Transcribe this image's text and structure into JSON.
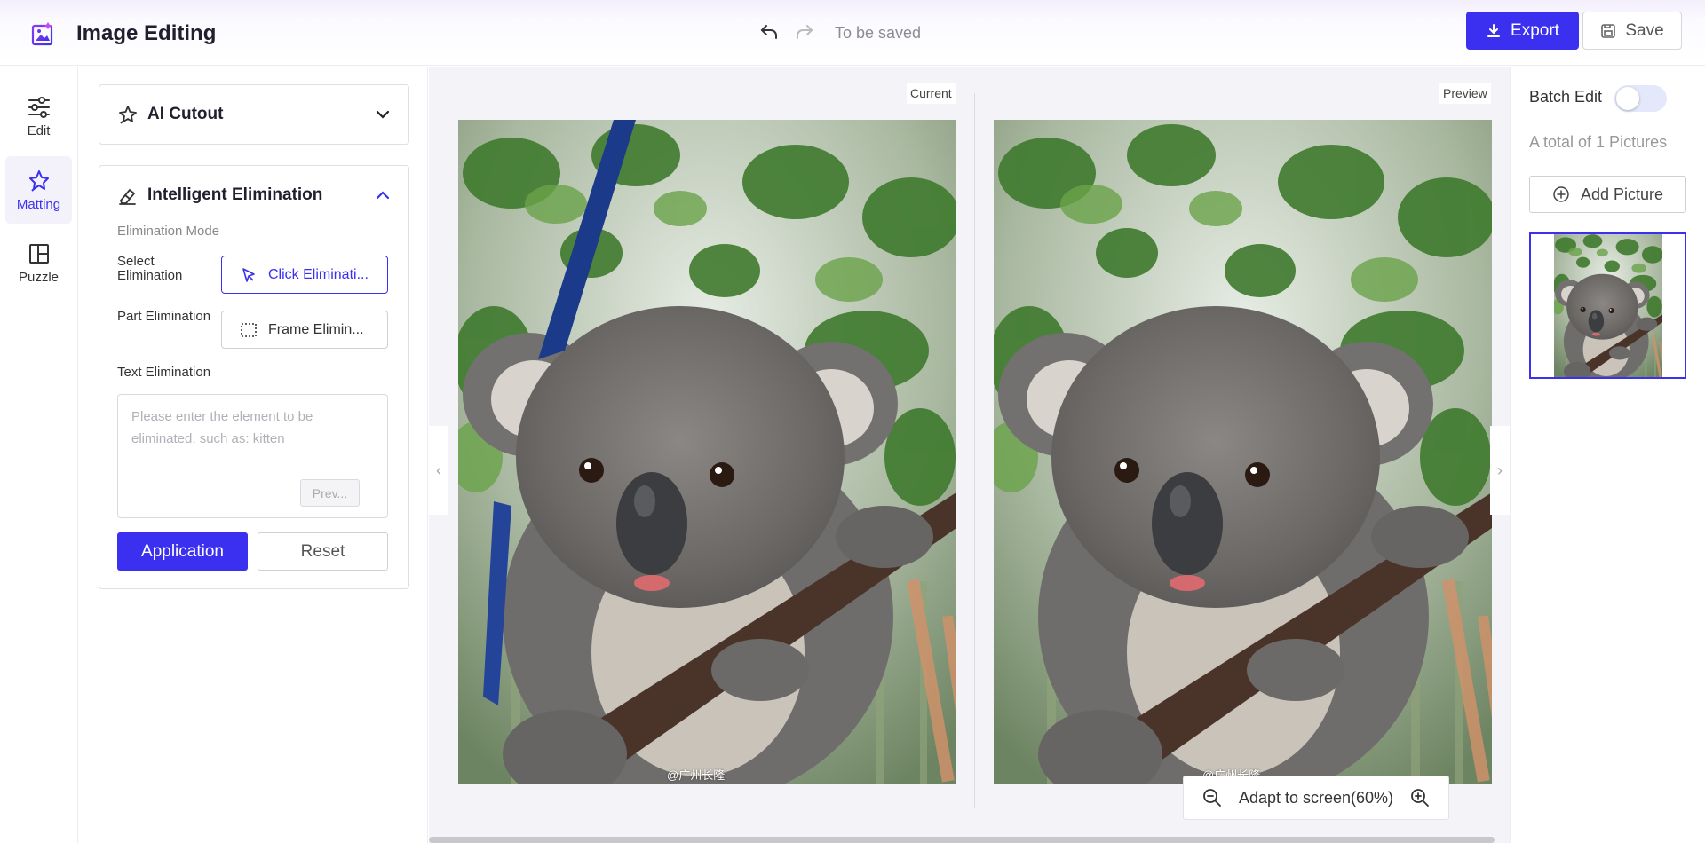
{
  "header": {
    "app_title": "Image Editing",
    "save_status": "To be saved",
    "export_label": "Export",
    "save_label": "Save"
  },
  "rail": {
    "items": [
      {
        "label": "Edit",
        "icon": "sliders-icon"
      },
      {
        "label": "Matting",
        "icon": "magic-star-icon"
      },
      {
        "label": "Puzzle",
        "icon": "layout-icon"
      }
    ],
    "active": "Matting"
  },
  "tools": {
    "ai_cutout": {
      "title": "AI Cutout",
      "expanded": false
    },
    "elimination": {
      "title": "Intelligent Elimination",
      "expanded": true,
      "mode_label": "Elimination Mode",
      "select_label_1": "Select",
      "select_label_2": "Elimination",
      "select_button": "Click Eliminati...",
      "part_label": "Part Elimination",
      "part_button": "Frame Elimin...",
      "text_label": "Text Elimination",
      "text_placeholder": "Please enter the element to be eliminated, such as: kitten",
      "preview_button": "Prev...",
      "apply_label": "Application",
      "reset_label": "Reset"
    }
  },
  "canvas": {
    "current_label": "Current",
    "preview_label": "Preview",
    "watermark": "@广州长隆",
    "zoom_text": "Adapt to screen(60%)"
  },
  "right_panel": {
    "batch_label": "Batch Edit",
    "batch_enabled": false,
    "total_text": "A total of 1 Pictures",
    "add_label": "Add Picture"
  },
  "colors": {
    "accent": "#3b30f0",
    "canvas_bg": "#f4f4f8"
  }
}
